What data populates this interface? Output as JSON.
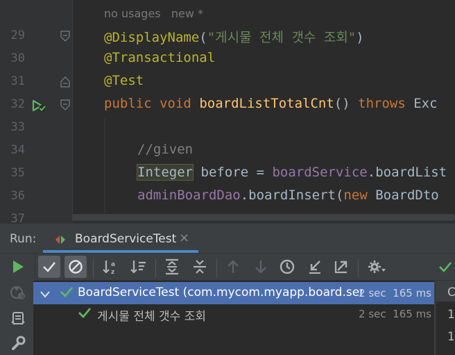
{
  "editor": {
    "hint": "no usages   new *",
    "lines": [
      {
        "num": "29"
      },
      {
        "num": "30"
      },
      {
        "num": "31"
      },
      {
        "num": "32"
      },
      {
        "num": "33"
      },
      {
        "num": "34"
      },
      {
        "num": "35"
      },
      {
        "num": "36"
      },
      {
        "num": "37"
      }
    ],
    "code": {
      "l29_ann": "@DisplayName",
      "l29_paren_open": "(",
      "l29_str": "\"게시물 전체 갯수 조회\"",
      "l29_paren_close": ")",
      "l30_ann": "@Transactional",
      "l31_ann": "@Test",
      "l32_kw1": "public",
      "l32_kw2": "void",
      "l32_fn": "boardListTotalCnt",
      "l32_parens": "()",
      "l32_kw3": "throws",
      "l32_exc": "Exc",
      "l34_cmt": "//given",
      "l35_type": "Integer",
      "l35_rest1": " before = ",
      "l35_fld": "boardService",
      "l35_rest2": ".boardList",
      "l36_fld": "adminBoardDao",
      "l36_rest1": ".boardInsert(",
      "l36_kw": "new",
      "l36_rest2": " BoardDto"
    }
  },
  "run_panel": {
    "label": "Run:",
    "tab_name": "BoardServiceTest",
    "tab_close": "×",
    "tree": [
      {
        "text": "BoardServiceTest (com.mycom.myapp.board.servic",
        "time": "2 sec  165 ms",
        "status": "passed"
      },
      {
        "text": "게시물 전체 갯수 조회",
        "time": "2 sec  165 ms",
        "status": "passed"
      }
    ],
    "right_pane": [
      "C",
      "1",
      "1"
    ]
  },
  "colors": {
    "accent": "#4a88c7",
    "pass": "#5fb760",
    "selection": "#4b6eaf"
  }
}
